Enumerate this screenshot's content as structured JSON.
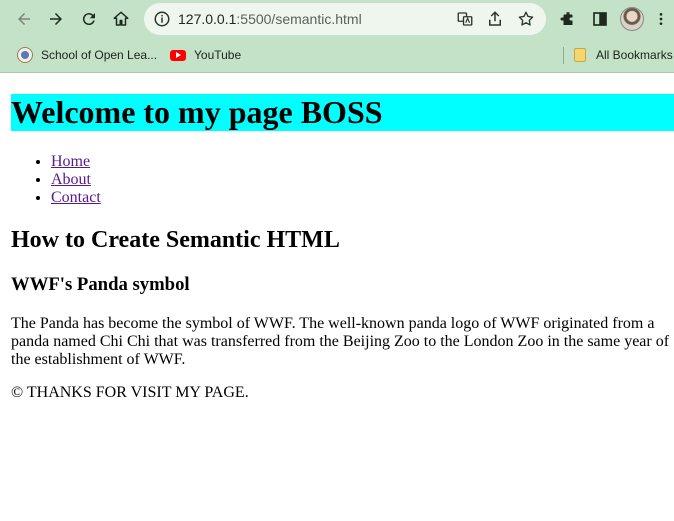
{
  "browser": {
    "url_host": "127.0.0.1",
    "url_path": ":5500/semantic.html",
    "bookmarks": [
      {
        "label": "School of Open Lea..."
      },
      {
        "label": "YouTube"
      }
    ],
    "all_bookmarks_label": "All Bookmarks",
    "colors": {
      "chrome": "#c4e2c7",
      "omnibox": "#eef6ee"
    }
  },
  "page": {
    "hero_title": "Welcome to my page BOSS",
    "hero_bg": "#00ffff",
    "nav": [
      {
        "label": "Home"
      },
      {
        "label": "About"
      },
      {
        "label": "Contact"
      }
    ],
    "heading": "How to Create Semantic HTML",
    "subheading": "WWF's Panda symbol",
    "paragraph": "The Panda has become the symbol of WWF. The well-known panda logo of WWF originated from a panda named Chi Chi that was transferred from the Beijing Zoo to the London Zoo in the same year of the establishment of WWF.",
    "footer": "© THANKS FOR VISIT MY PAGE.",
    "link_color": "#551a8b"
  }
}
